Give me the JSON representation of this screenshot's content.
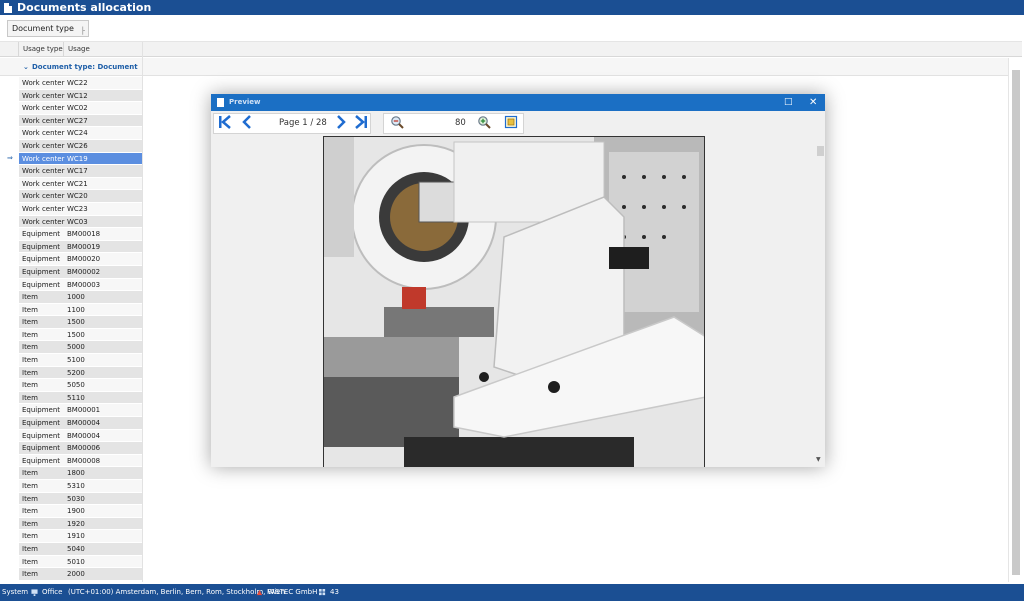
{
  "window": {
    "title": "Documents allocation"
  },
  "group_panel": {
    "chip_label": "Document type"
  },
  "grid": {
    "columns": [
      "Usage type",
      "Usage"
    ],
    "group_label": "Document type: Document",
    "rows": [
      [
        "Work center",
        "WC22"
      ],
      [
        "Work center",
        "WC12"
      ],
      [
        "Work center",
        "WC02"
      ],
      [
        "Work center",
        "WC27"
      ],
      [
        "Work center",
        "WC24"
      ],
      [
        "Work center",
        "WC26"
      ],
      [
        "Work center",
        "WC19"
      ],
      [
        "Work center",
        "WC17"
      ],
      [
        "Work center",
        "WC21"
      ],
      [
        "Work center",
        "WC20"
      ],
      [
        "Work center",
        "WC23"
      ],
      [
        "Work center",
        "WC03"
      ],
      [
        "Equipment",
        "BM00018"
      ],
      [
        "Equipment",
        "BM00019"
      ],
      [
        "Equipment",
        "BM00020"
      ],
      [
        "Equipment",
        "BM00002"
      ],
      [
        "Equipment",
        "BM00003"
      ],
      [
        "Item",
        "1000"
      ],
      [
        "Item",
        "1100"
      ],
      [
        "Item",
        "1500"
      ],
      [
        "Item",
        "1500"
      ],
      [
        "Item",
        "5000"
      ],
      [
        "Item",
        "5100"
      ],
      [
        "Item",
        "5200"
      ],
      [
        "Item",
        "5050"
      ],
      [
        "Item",
        "5110"
      ],
      [
        "Equipment",
        "BM00001"
      ],
      [
        "Equipment",
        "BM00004"
      ],
      [
        "Equipment",
        "BM00004"
      ],
      [
        "Equipment",
        "BM00006"
      ],
      [
        "Equipment",
        "BM00008"
      ],
      [
        "Item",
        "1800"
      ],
      [
        "Item",
        "5310"
      ],
      [
        "Item",
        "5030"
      ],
      [
        "Item",
        "1900"
      ],
      [
        "Item",
        "1920"
      ],
      [
        "Item",
        "1910"
      ],
      [
        "Item",
        "5040"
      ],
      [
        "Item",
        "5010"
      ],
      [
        "Item",
        "2000"
      ]
    ],
    "selected_row": 6
  },
  "preview": {
    "title": "Preview",
    "page_label": "Page 1 / 28",
    "zoom_value": "80",
    "icons": [
      "first-page-icon",
      "previous-page-icon",
      "next-page-icon",
      "last-page-icon",
      "zoom-out-icon",
      "zoom-in-icon",
      "fit-page-icon",
      "maximize-icon",
      "close-icon"
    ]
  },
  "status": {
    "system": "System",
    "location": "Office",
    "timezone": "(UTC+01:00) Amsterdam, Berlin, Bern, Rom, Stockholm, Wien",
    "company": "FASTEC GmbH",
    "count": "43"
  },
  "colors": {
    "title_bar": "#1b4f93",
    "preview_title": "#1b6fc4",
    "selection": "#5b8ee0",
    "accent": "#1f6cd0"
  }
}
